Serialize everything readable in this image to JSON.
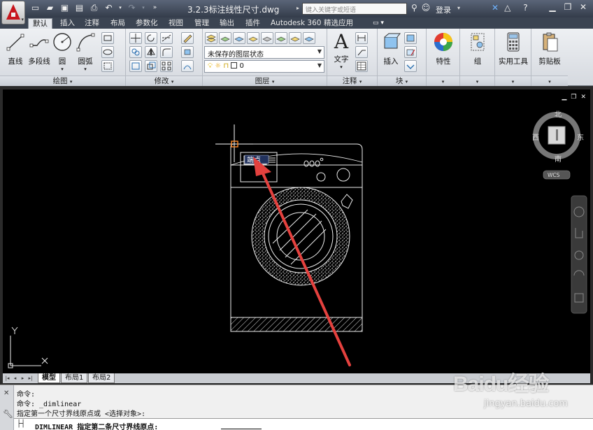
{
  "window": {
    "title": "3.2.3标注线性尺寸.dwg",
    "search_placeholder": "键入关键字或短语",
    "login_label": "登录"
  },
  "ribbon": {
    "tabs": [
      "默认",
      "插入",
      "注释",
      "布局",
      "参数化",
      "视图",
      "管理",
      "输出",
      "插件",
      "Autodesk 360",
      "精选应用"
    ],
    "active_tab": "默认",
    "draw_panel": {
      "title": "绘图",
      "tools": [
        "直线",
        "多段线",
        "圆",
        "圆弧"
      ]
    },
    "modify_panel": {
      "title": "修改"
    },
    "layers_panel": {
      "title": "图层",
      "layer_state": "未保存的图层状态",
      "current_layer": "0"
    },
    "annotation_panel": {
      "title": "注释",
      "text_tool": "文字"
    },
    "block_panel": {
      "title": "块",
      "insert_tool": "插入"
    },
    "properties_tool": "特性",
    "group_tool": "组",
    "utilities_tool": "实用工具",
    "clipboard_tool": "剪贴板"
  },
  "viewcube": {
    "north": "北",
    "south": "南",
    "east": "东",
    "west": "西",
    "ucs": "WCS"
  },
  "drawing": {
    "snap_tooltip": "端点",
    "ucs_x": "X",
    "ucs_y": "Y"
  },
  "layout_tabs": [
    "模型",
    "布局1",
    "布局2"
  ],
  "command": {
    "history": [
      "命令:",
      "命令: _dimlinear",
      "指定第一个尺寸界线原点或 <选择对象>:"
    ],
    "prompt": "DIMLINEAR 指定第二条尺寸界线原点:"
  },
  "watermark": {
    "brand": "Baidu经验",
    "url": "jingyan.baidu.com"
  }
}
